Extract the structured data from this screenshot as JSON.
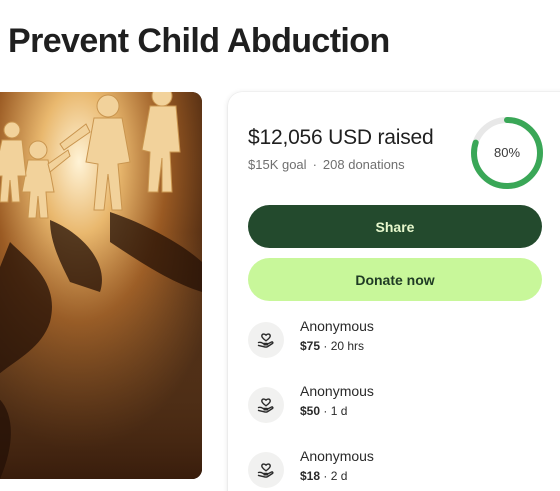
{
  "page": {
    "title": "Prevent Child Abduction"
  },
  "fundraiser": {
    "raised_text": "$12,056 USD raised",
    "goal_text": "$15K goal",
    "separator": "·",
    "donations_text": "208 donations",
    "progress_label": "80%",
    "progress_fraction": 0.8,
    "progress_color": "#3aa757",
    "track_color": "#e8e8e8"
  },
  "actions": {
    "share_label": "Share",
    "donate_label": "Donate now"
  },
  "donations": [
    {
      "name": "Anonymous",
      "amount": "$75",
      "time": " · 20 hrs",
      "icon": "heart-hand-icon"
    },
    {
      "name": "Anonymous",
      "amount": "$50",
      "time": " · 1 d",
      "icon": "heart-hand-icon"
    },
    {
      "name": "Anonymous",
      "amount": "$18",
      "time": " · 2 d",
      "icon": "heart-hand-icon"
    }
  ],
  "colors": {
    "share_bg": "#234a2d",
    "donate_bg": "#c8f79a"
  }
}
